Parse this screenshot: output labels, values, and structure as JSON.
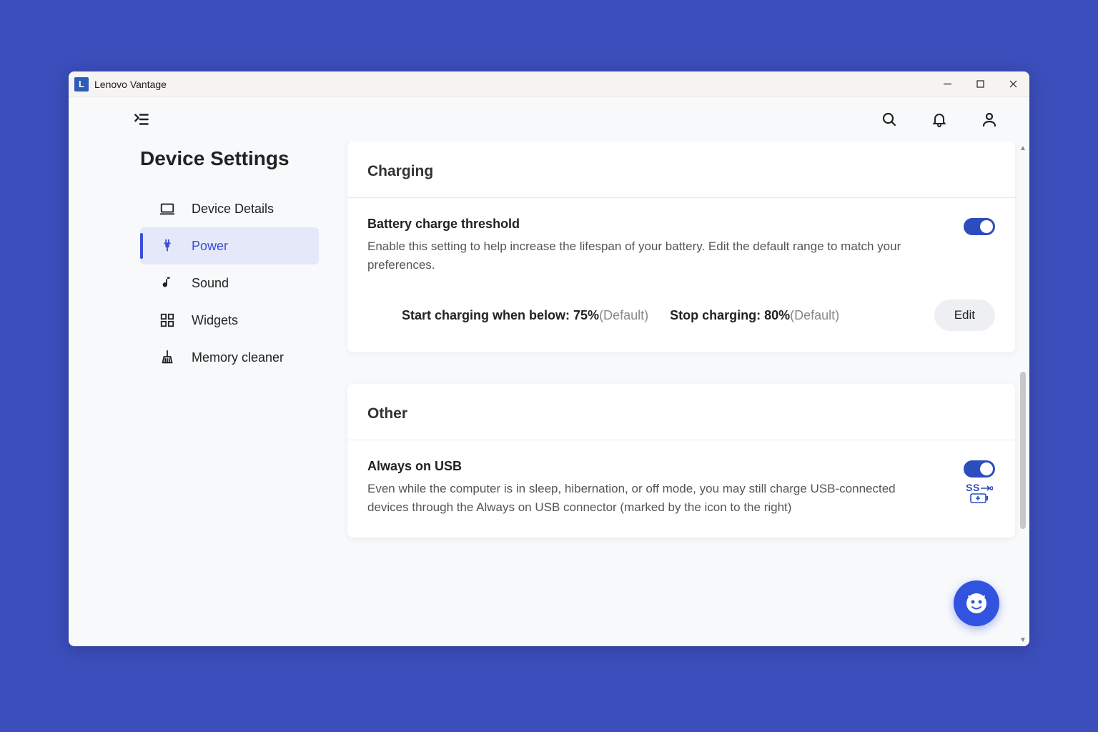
{
  "titlebar": {
    "icon_letter": "L",
    "title": "Lenovo Vantage"
  },
  "sidebar": {
    "title": "Device Settings",
    "items": [
      {
        "label": "Device Details"
      },
      {
        "label": "Power"
      },
      {
        "label": "Sound"
      },
      {
        "label": "Widgets"
      },
      {
        "label": "Memory cleaner"
      }
    ]
  },
  "charging": {
    "header": "Charging",
    "threshold_title": "Battery charge threshold",
    "threshold_desc": "Enable this setting to help increase the lifespan of your battery. Edit the default range to match your preferences.",
    "start_label": "Start charging when below: ",
    "start_value": "75%",
    "start_default": "(Default)",
    "stop_label": "Stop charging: ",
    "stop_value": "80%",
    "stop_default": "(Default)",
    "edit_label": "Edit"
  },
  "other": {
    "header": "Other",
    "usb_title": "Always on USB",
    "usb_desc": "Even while the computer is in sleep, hibernation, or off mode, you may still charge USB-connected devices through the Always on USB connector (marked by the icon to the right)",
    "ss_label": "SS"
  }
}
